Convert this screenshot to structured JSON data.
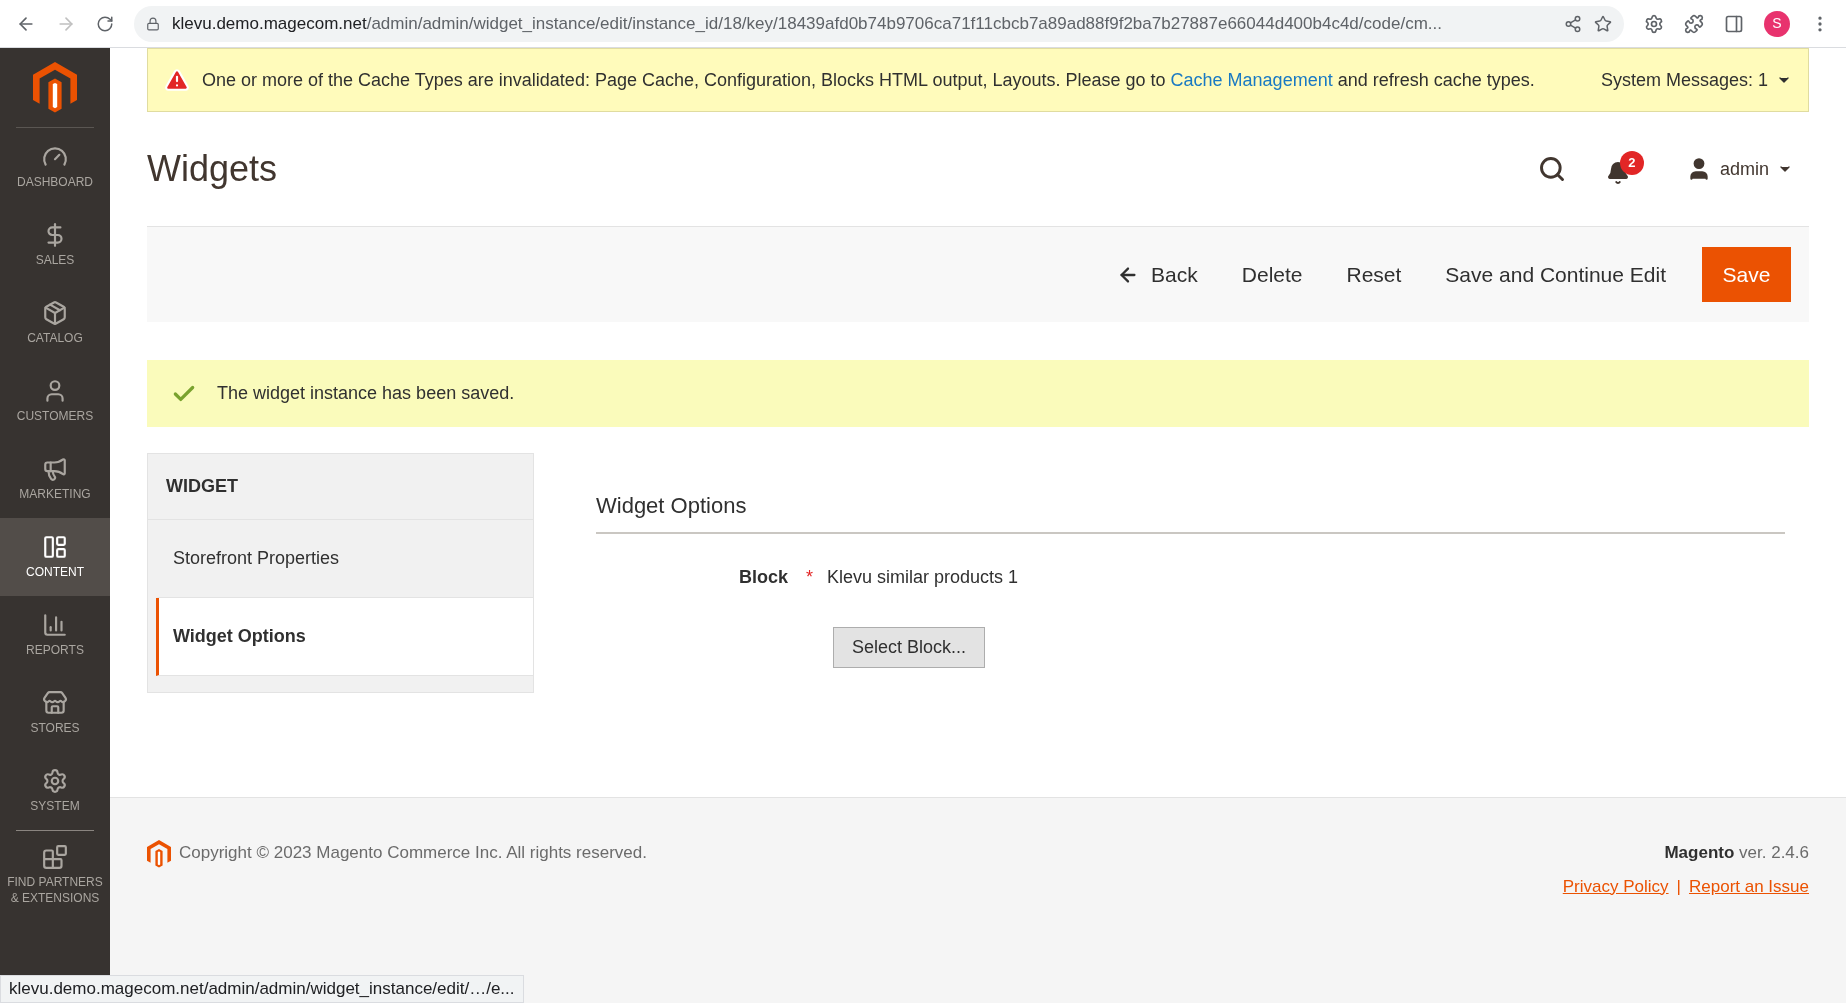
{
  "browser": {
    "url_host": "klevu.demo.magecom.net",
    "url_path": "/admin/admin/widget_instance/edit/instance_id/18/key/18439afd0b74b9706ca71f11cbcb7a89ad88f9f2ba7b27887e66044d400b4c4d/code/cm...",
    "profile_initial": "S",
    "status_url": "klevu.demo.magecom.net/admin/admin/widget_instance/edit/…/e..."
  },
  "sidebar": {
    "items": [
      {
        "kind": "dashboard",
        "label": "DASHBOARD",
        "selected": false
      },
      {
        "kind": "sales",
        "label": "SALES",
        "selected": false
      },
      {
        "kind": "catalog",
        "label": "CATALOG",
        "selected": false
      },
      {
        "kind": "customers",
        "label": "CUSTOMERS",
        "selected": false
      },
      {
        "kind": "marketing",
        "label": "MARKETING",
        "selected": false
      },
      {
        "kind": "content",
        "label": "CONTENT",
        "selected": true
      },
      {
        "kind": "reports",
        "label": "REPORTS",
        "selected": false
      },
      {
        "kind": "stores",
        "label": "STORES",
        "selected": false
      },
      {
        "kind": "system",
        "label": "SYSTEM",
        "selected": false
      },
      {
        "kind": "partners",
        "label": "FIND PARTNERS & EXTENSIONS",
        "selected": false
      }
    ]
  },
  "system_message": {
    "text_before": "One or more of the Cache Types are invalidated: Page Cache, Configuration, Blocks HTML output, Layouts. Please go to",
    "link": "Cache Management",
    "text_after": "and refresh cache types.",
    "counter": "System Messages: 1"
  },
  "page_title": "Widgets",
  "header": {
    "notifications": "2",
    "user": "admin"
  },
  "actions": {
    "back": "Back",
    "delete": "Delete",
    "reset": "Reset",
    "save_continue": "Save and Continue Edit",
    "save": "Save"
  },
  "success_message": "The widget instance has been saved.",
  "tabs": {
    "title": "WIDGET",
    "items": [
      {
        "label": "Storefront Properties",
        "selected": false
      },
      {
        "label": "Widget Options",
        "selected": true
      }
    ]
  },
  "section": {
    "title": "Widget Options",
    "field_label": "Block",
    "required_mark": "*",
    "field_value": "Klevu similar products 1",
    "button": "Select Block..."
  },
  "footer": {
    "copyright": "Copyright © 2023 Magento Commerce Inc. All rights reserved.",
    "brand": "Magento",
    "version": "ver. 2.4.6",
    "links": [
      "Privacy Policy",
      "Report an Issue"
    ],
    "separator": "|"
  }
}
